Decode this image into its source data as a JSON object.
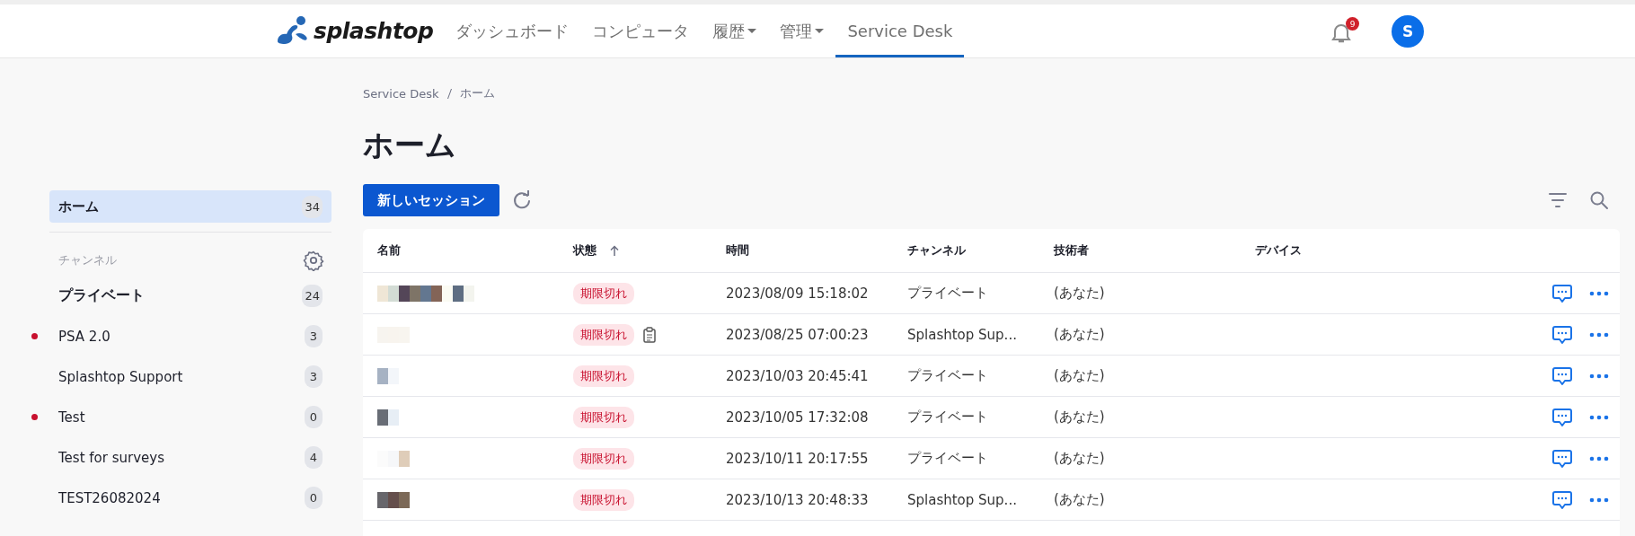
{
  "header": {
    "logo": "splashtop",
    "nav": [
      {
        "label": "ダッシュボード",
        "dropdown": false,
        "selected": false
      },
      {
        "label": "コンピュータ",
        "dropdown": false,
        "selected": false
      },
      {
        "label": "履歴",
        "dropdown": true,
        "selected": false
      },
      {
        "label": "管理",
        "dropdown": true,
        "selected": false
      },
      {
        "label": "Service Desk",
        "dropdown": false,
        "selected": true
      }
    ],
    "notifications": "9",
    "avatar": "S"
  },
  "sidebar": {
    "items": [
      {
        "label": "ホーム",
        "count": "34",
        "selected": true
      }
    ],
    "channels_title": "チャンネル",
    "channels": [
      {
        "label": "プライベート",
        "count": "24",
        "kind": "personal",
        "unread": false,
        "selected": false
      },
      {
        "label": "PSA 2.0",
        "count": "3",
        "kind": "shared",
        "unread": true,
        "selected": false
      },
      {
        "label": "Splashtop Support",
        "count": "3",
        "kind": "shared",
        "unread": false,
        "selected": false
      },
      {
        "label": "Test",
        "count": "0",
        "kind": "shared",
        "unread": true,
        "selected": false
      },
      {
        "label": "Test for surveys",
        "count": "4",
        "kind": "shared",
        "unread": false,
        "selected": false
      },
      {
        "label": "TEST26082024",
        "count": "0",
        "kind": "shared",
        "unread": false,
        "selected": false
      }
    ]
  },
  "breadcrumb": [
    "Service Desk",
    "ホーム"
  ],
  "title": "ホーム",
  "new_session_button": "新しいセッション",
  "table": {
    "columns": [
      {
        "label": "名前",
        "sorted": false
      },
      {
        "label": "状態",
        "sorted": true
      },
      {
        "label": "時間",
        "sorted": false
      },
      {
        "label": "チャンネル",
        "sorted": false
      },
      {
        "label": "技術者",
        "sorted": false
      },
      {
        "label": "デバイス",
        "sorted": false
      }
    ],
    "rows": [
      {
        "status": "期限切れ",
        "has_note": false,
        "time": "2023/08/09 15:18:02",
        "channel": "プライベート",
        "technician": "(あなた)"
      },
      {
        "status": "期限切れ",
        "has_note": true,
        "time": "2023/08/25 07:00:23",
        "channel": "Splashtop Sup...",
        "technician": "(あなた)"
      },
      {
        "status": "期限切れ",
        "has_note": false,
        "time": "2023/10/03 20:45:41",
        "channel": "プライベート",
        "technician": "(あなた)"
      },
      {
        "status": "期限切れ",
        "has_note": false,
        "time": "2023/10/05 17:32:08",
        "channel": "プライベート",
        "technician": "(あなた)"
      },
      {
        "status": "期限切れ",
        "has_note": false,
        "time": "2023/10/11 20:17:55",
        "channel": "プライベート",
        "technician": "(あなた)"
      },
      {
        "status": "期限切れ",
        "has_note": false,
        "time": "2023/10/13 20:48:33",
        "channel": "Splashtop Sup...",
        "technician": "(あなた)"
      }
    ]
  }
}
